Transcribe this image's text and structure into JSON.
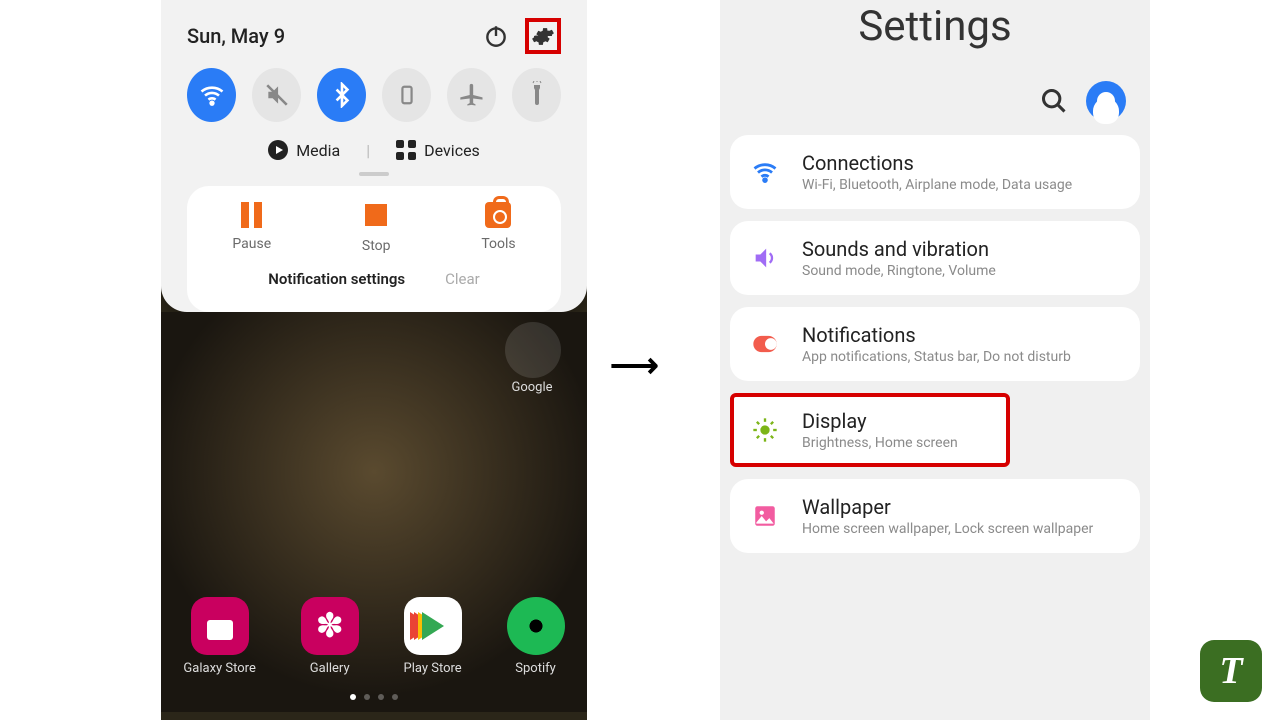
{
  "left": {
    "date": "Sun, May 9",
    "media_label": "Media",
    "devices_label": "Devices",
    "actions": {
      "pause": "Pause",
      "stop": "Stop",
      "tools": "Tools"
    },
    "notif_settings": "Notification settings",
    "clear": "Clear",
    "folder": "Google",
    "apps": {
      "galaxy_store": "Galaxy Store",
      "gallery": "Gallery",
      "play_store": "Play Store",
      "spotify": "Spotify"
    }
  },
  "right": {
    "title": "Settings",
    "items": [
      {
        "title": "Connections",
        "sub": "Wi-Fi, Bluetooth, Airplane mode, Data usage"
      },
      {
        "title": "Sounds and vibration",
        "sub": "Sound mode, Ringtone, Volume"
      },
      {
        "title": "Notifications",
        "sub": "App notifications, Status bar, Do not disturb"
      },
      {
        "title": "Display",
        "sub": "Brightness, Home screen"
      },
      {
        "title": "Wallpaper",
        "sub": "Home screen wallpaper, Lock screen wallpaper"
      }
    ]
  },
  "colors": {
    "accent_blue": "#2a7cf6",
    "highlight_red": "#d60000",
    "orange": "#f06a1a",
    "badge_green": "#3b6e22"
  },
  "badge": "T"
}
